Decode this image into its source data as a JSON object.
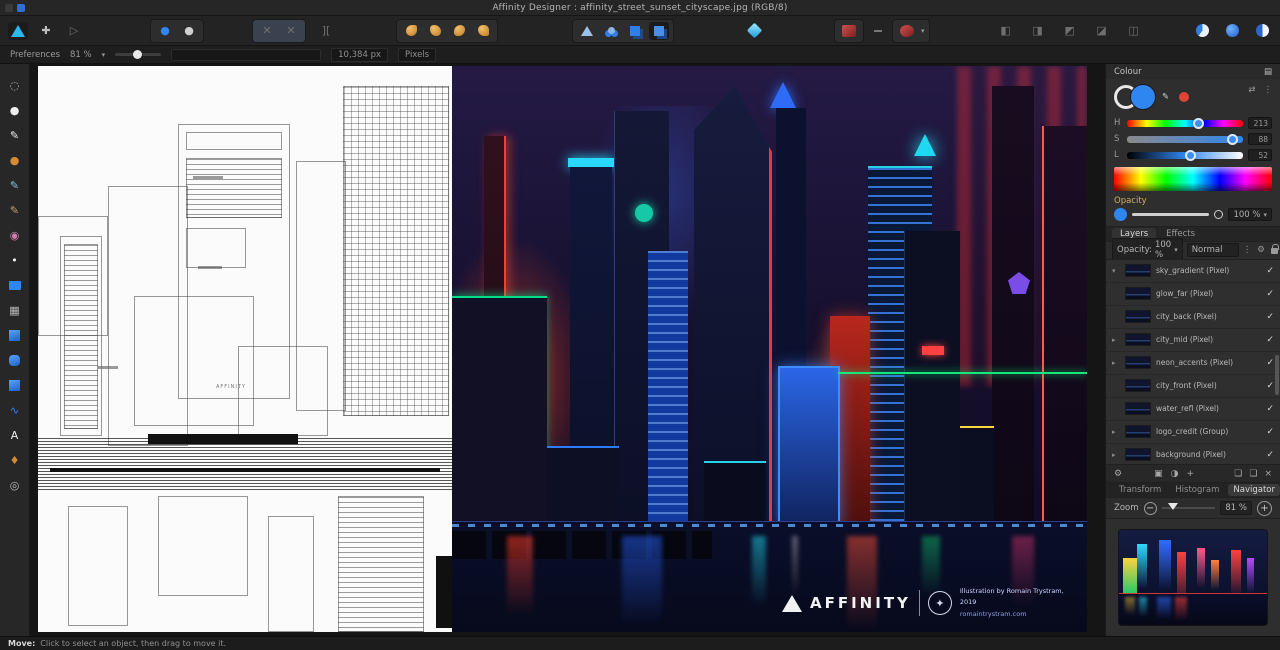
{
  "titlebar": {
    "title": "Affinity Designer : affinity_street_sunset_cityscape.jpg (RGB/8)"
  },
  "contextbar": {
    "label": "Preferences",
    "zoom": "81 %",
    "size": "10,384 px",
    "units": "Pixels"
  },
  "icons": {
    "kebab": "⋮",
    "gear": "⚙",
    "swap": "⇄",
    "pencil": "✎",
    "check": "✓",
    "caret_down": "▾",
    "caret_right": "▸",
    "minus_circle": "−",
    "plus": "+",
    "duplicate": "❏",
    "delete": "×",
    "mask": "▣",
    "adjustment": "◑",
    "move": "✚",
    "node": "▷",
    "snap_left": "✕",
    "snap_right": "✕",
    "options": "][",
    "dim1": "◧",
    "dim2": "◨",
    "dim3": "◩",
    "dim4": "◪",
    "dim5": "◫",
    "insert_a": "●",
    "insert_b": "●",
    "panel_menu": "▤"
  },
  "tools": [
    {
      "name": "view-tool",
      "glyph": "◌",
      "cls": "t-gray"
    },
    {
      "name": "move-tool",
      "glyph": "●",
      "cls": "t-white"
    },
    {
      "name": "node-tool",
      "glyph": "✎",
      "cls": "t-white"
    },
    {
      "name": "vector-brush-tool",
      "glyph": "●",
      "cls": "t-orange"
    },
    {
      "name": "pencil-tool",
      "glyph": "✎",
      "cls": "t-cyan"
    },
    {
      "name": "brush-tool",
      "glyph": "✎",
      "cls": "t-tan"
    },
    {
      "name": "fill-tool",
      "glyph": "◉",
      "cls": "t-pink"
    },
    {
      "name": "transparency-tool",
      "glyph": "•",
      "cls": "t-white"
    },
    {
      "name": "artboard-tool",
      "glyph": "",
      "cls": "chip-blue"
    },
    {
      "name": "grid-tool",
      "glyph": "▦",
      "cls": "t-gray"
    },
    {
      "name": "rectangle-tool",
      "glyph": "",
      "cls": "sq-blue"
    },
    {
      "name": "rounded-rectangle-tool",
      "glyph": "",
      "cls": "sq-blue sq-round"
    },
    {
      "name": "ellipse-tool",
      "glyph": "",
      "cls": "sq-blue"
    },
    {
      "name": "curve-shape-tool",
      "glyph": "∿",
      "cls": "t-blue"
    },
    {
      "name": "text-tool",
      "glyph": "A",
      "cls": "t-white"
    },
    {
      "name": "colour-picker-tool",
      "glyph": "♦",
      "cls": "t-orange"
    },
    {
      "name": "zoom-tool",
      "glyph": "◎",
      "cls": "t-gray"
    }
  ],
  "colour_panel": {
    "title": "Colour",
    "h_label": "H",
    "h_value": "213",
    "s_label": "S",
    "s_value": "88",
    "l_label": "L",
    "l_value": "52",
    "opacity_label": "Opacity",
    "opacity_value": "100 %",
    "fill_color": "#2f86f0"
  },
  "panel_tabs": {
    "left": "Layers",
    "right": "Effects"
  },
  "layers_panel": {
    "opacity_label": "Opacity:",
    "opacity_value": "100 %",
    "blend_mode": "Normal",
    "items": [
      {
        "caret": "▾",
        "name": "sky_gradient (Pixel)",
        "check": "✓"
      },
      {
        "caret": "",
        "name": "glow_far (Pixel)",
        "check": "✓"
      },
      {
        "caret": "",
        "name": "city_back (Pixel)",
        "check": "✓"
      },
      {
        "caret": "▸",
        "name": "city_mid (Pixel)",
        "check": "✓"
      },
      {
        "caret": "▸",
        "name": "neon_accents (Pixel)",
        "check": "✓"
      },
      {
        "caret": "",
        "name": "city_front (Pixel)",
        "check": "✓"
      },
      {
        "caret": "",
        "name": "water_refl (Pixel)",
        "check": "✓"
      },
      {
        "caret": "▸",
        "name": "logo_credit (Group)",
        "check": "✓"
      },
      {
        "caret": "▸",
        "name": "background (Pixel)",
        "check": "✓"
      }
    ]
  },
  "studio_tabs": {
    "tab1": "Transform",
    "tab2": "Histogram",
    "tab3": "Navigator"
  },
  "navigator": {
    "label": "Zoom",
    "value": "81 %"
  },
  "artwork": {
    "brand": "AFFINITY",
    "credit_line1": "Illustration by Romain Trystram, 2019",
    "credit_line2": "romaintrystram.com",
    "wireframe_label": "AFFINITY"
  },
  "statusbar": {
    "tool": "Move:",
    "hint": "Click to select an object, then drag to move it."
  },
  "colors": {
    "accent": "#2f86f0",
    "neon_cyan": "#1fd9f0",
    "neon_green": "#14e87a",
    "neon_red": "#ff3b30",
    "canvas_bg": "#151515"
  }
}
